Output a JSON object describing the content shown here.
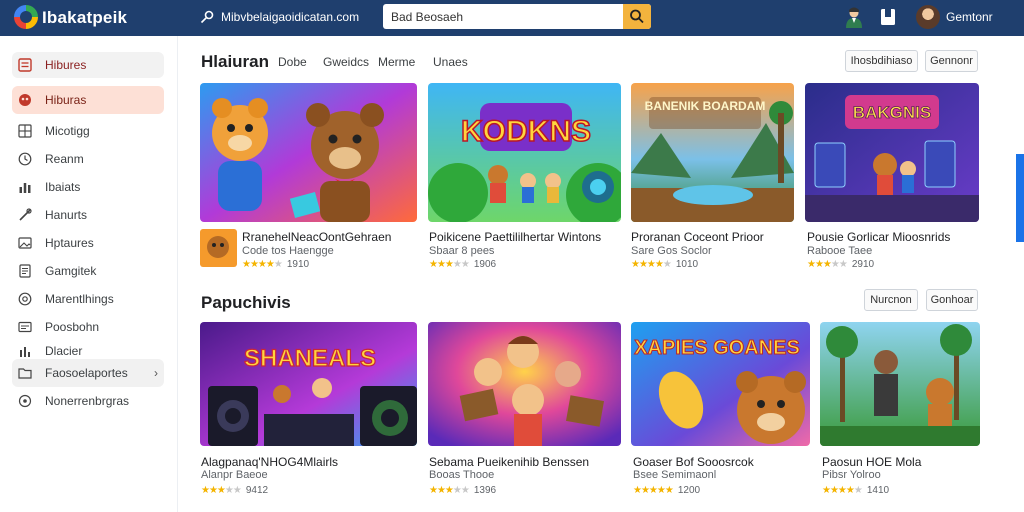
{
  "topbar": {
    "app_name": "Ibakatpeik",
    "url": "Mibvbelaigaoidicatan.com",
    "search_value": "Bad Beosaeh",
    "user_name": "Gemtonr"
  },
  "sidebar": {
    "items": [
      {
        "label": "Hibures",
        "icon": "list-icon"
      },
      {
        "label": "Hiburas",
        "icon": "game-icon"
      },
      {
        "label": "Micotigg",
        "icon": "grid-icon"
      },
      {
        "label": "Reanm",
        "icon": "clock-icon"
      },
      {
        "label": "Ibaiats",
        "icon": "chart-icon"
      },
      {
        "label": "Hanurts",
        "icon": "wrench-icon"
      },
      {
        "label": "Hptaures",
        "icon": "image-icon"
      },
      {
        "label": "Gamgitek",
        "icon": "doc-icon"
      },
      {
        "label": "Marentlhings",
        "icon": "target-icon"
      },
      {
        "label": "Poosbohn",
        "icon": "card-icon"
      },
      {
        "label": "Dlacier",
        "icon": "bars-icon"
      },
      {
        "label": "Faosoelaportes",
        "icon": "folder-icon"
      },
      {
        "label": "Nonerrenbrgras",
        "icon": "settings-icon"
      }
    ]
  },
  "section1": {
    "title": "Hlaiuran",
    "tabs": [
      "Dobe",
      "Gweidcs",
      "Merme",
      "Unaes"
    ],
    "buttons": [
      "Ihosbdihiaso",
      "Gennonr"
    ],
    "cards": [
      {
        "title": "RranehelNeacOontGehraen",
        "sub": "Code tos Haengge",
        "stars": 4,
        "count": "1910"
      },
      {
        "title": "Poikicene Paettililhertar Wintons",
        "sub": "Sbaar 8 pees",
        "stars": 3,
        "count": "1906"
      },
      {
        "title": "Proranan Coceont Prioor",
        "sub": "Sare Gos Soclor",
        "stars": 4,
        "count": "1010"
      },
      {
        "title": "Pousie Gorlicar Mioosnrids",
        "sub": "Rabooe Taee",
        "stars": 3,
        "count": "2910"
      }
    ]
  },
  "section2": {
    "title": "Papuchivis",
    "buttons": [
      "Nurcnon",
      "Gonhoar"
    ],
    "cards": [
      {
        "title": "Alagpanaq'NHOG4Mlairls",
        "sub": "Alanpr Baeoe",
        "stars": 3,
        "count": "9412"
      },
      {
        "title": "Sebama Pueikenihib Benssen",
        "sub": "Booas Thooe",
        "stars": 3,
        "count": "1396"
      },
      {
        "title": "Goaser Bof Sooosrcok",
        "sub": "Bsee Semimaonl",
        "stars": 5,
        "count": "1200"
      },
      {
        "title": "Paosun HOE Mola",
        "sub": "Pibsr Yolroo",
        "stars": 4,
        "count": "1410"
      }
    ]
  },
  "art": {
    "s1": [
      "",
      "KODKNS",
      "BANENIK BOARDAM",
      "BAKGNIS"
    ],
    "s2": [
      "SHANEALS",
      "",
      "XAPIES GOANES",
      ""
    ]
  }
}
